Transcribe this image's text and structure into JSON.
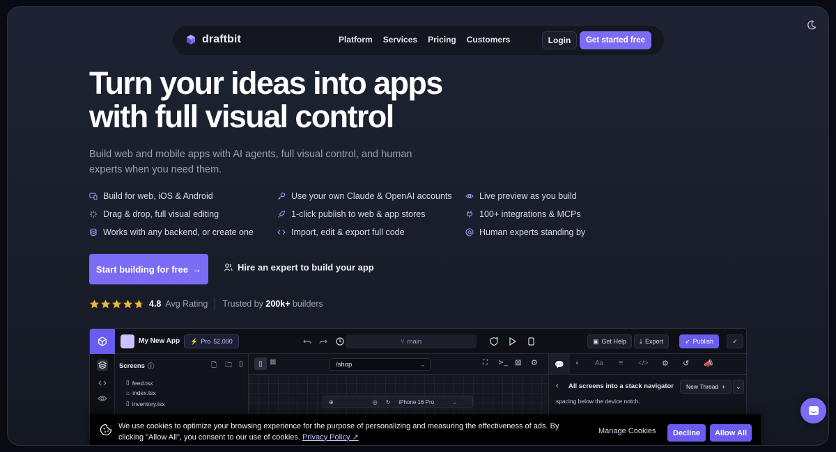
{
  "brand": {
    "name": "draftbit",
    "accent": "#7b6cf6"
  },
  "nav": {
    "links": [
      "Platform",
      "Services",
      "Pricing",
      "Customers"
    ],
    "login": "Login",
    "get_started": "Get started free"
  },
  "hero": {
    "title_line1": "Turn your ideas into apps",
    "title_line2": "with full visual control",
    "subtitle": "Build web and mobile apps with AI agents, full visual control, and human experts when you need them."
  },
  "features": [
    {
      "icon": "devices-icon",
      "label": "Build for web, iOS & Android"
    },
    {
      "icon": "key-icon",
      "label": "Use your own Claude & OpenAI accounts"
    },
    {
      "icon": "eye-icon",
      "label": "Live preview as you build"
    },
    {
      "icon": "sparkle-icon",
      "label": "Drag & drop, full visual editing"
    },
    {
      "icon": "rocket-icon",
      "label": "1-click publish to web & app stores"
    },
    {
      "icon": "plug-icon",
      "label": "100+ integrations & MCPs"
    },
    {
      "icon": "database-icon",
      "label": "Works with any backend, or create one"
    },
    {
      "icon": "code-icon",
      "label": "Import, edit & export full code"
    },
    {
      "icon": "at-icon",
      "label": "Human experts standing by"
    }
  ],
  "cta": {
    "primary": "Start building for free",
    "secondary": "Hire an expert to build your app"
  },
  "rating": {
    "stars": 4.8,
    "value": "4.8",
    "label": "Avg Rating",
    "trusted_prefix": "Trusted by",
    "trusted_count": "200k+",
    "trusted_suffix": "builders"
  },
  "app_preview": {
    "app_name": "My New App",
    "plan": "Pro",
    "credits": "52,000",
    "branch": "main",
    "get_help": "Get Help",
    "export": "Export",
    "publish": "Publish",
    "screens_title": "Screens",
    "screens": [
      "feed.tsx",
      "index.tsx",
      "inventory.tsx"
    ],
    "route": "/shop",
    "device": "iPhone 16 Pro",
    "thread_title": "All screens into a stack navigator",
    "new_thread": "New Thread",
    "thread_text": "spacing below the device notch."
  },
  "cookie": {
    "text": "We use cookies to optimize your browsing experience for the purpose of personalizing and measuring the effectiveness of ads. By clicking \"Allow All\", you consent to our use of cookies.",
    "link": "Privacy Policy ↗",
    "manage": "Manage Cookies",
    "decline": "Decline",
    "allow": "Allow All"
  }
}
